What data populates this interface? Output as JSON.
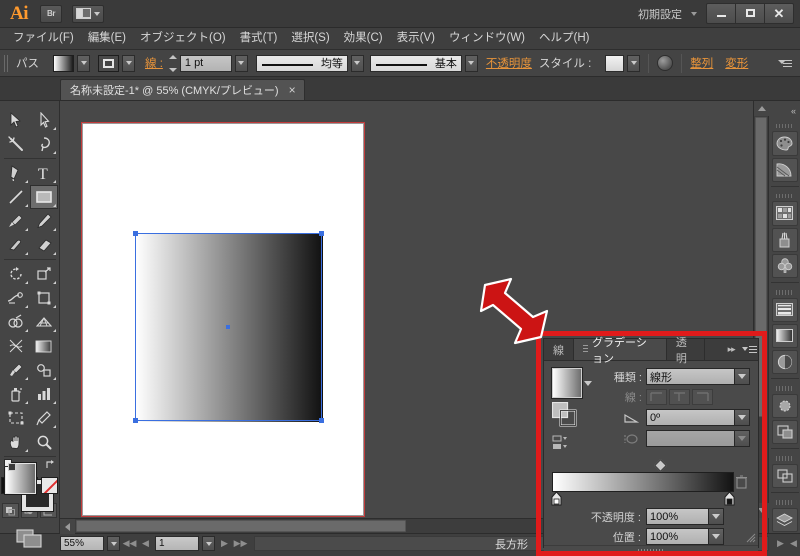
{
  "app": {
    "logo": "Ai",
    "bridge_label": "Br",
    "arrange_label": "arrange-documents",
    "workspace": "初期設定",
    "window_buttons": [
      "minimize",
      "maximize",
      "close"
    ]
  },
  "menubar": {
    "items": [
      {
        "label": "ファイル(F)",
        "name": "menu-file"
      },
      {
        "label": "編集(E)",
        "name": "menu-edit"
      },
      {
        "label": "オブジェクト(O)",
        "name": "menu-object"
      },
      {
        "label": "書式(T)",
        "name": "menu-type"
      },
      {
        "label": "選択(S)",
        "name": "menu-select"
      },
      {
        "label": "効果(C)",
        "name": "menu-effect"
      },
      {
        "label": "表示(V)",
        "name": "menu-view"
      },
      {
        "label": "ウィンドウ(W)",
        "name": "menu-window"
      },
      {
        "label": "ヘルプ(H)",
        "name": "menu-help"
      }
    ]
  },
  "controlbar": {
    "selection_label": "パス",
    "fill_swatch": "gradient-white-to-black",
    "stroke_swatch": "stroke-none",
    "stroke_label": "線 :",
    "stroke_weight": "1 pt",
    "stroke_profile": "均等",
    "brush_definition": "基本",
    "opacity_label": "不透明度",
    "style_label": "スタイル :",
    "style_swatch": "default-style",
    "effects_icon": "fx-circle-icon",
    "align_label": "整列",
    "transform_label": "変形",
    "panel_menu": "panel-menu-icon"
  },
  "tabbar": {
    "document_title": "名称未設定-1* @ 55% (CMYK/プレビュー)",
    "close_glyph": "×"
  },
  "toolbar": {
    "tools": [
      {
        "name": "tool-selection",
        "icon": "arrow-solid-icon"
      },
      {
        "name": "tool-direct-selection",
        "icon": "arrow-hollow-icon"
      },
      {
        "name": "tool-magic-wand",
        "icon": "magic-wand-icon"
      },
      {
        "name": "tool-lasso",
        "icon": "lasso-icon"
      },
      {
        "name": "tool-pen",
        "icon": "pen-icon"
      },
      {
        "name": "tool-type",
        "icon": "type-t-icon"
      },
      {
        "name": "tool-line-segment",
        "icon": "line-icon"
      },
      {
        "name": "tool-rectangle",
        "icon": "rectangle-icon",
        "selected": true
      },
      {
        "name": "tool-paintbrush",
        "icon": "paintbrush-icon"
      },
      {
        "name": "tool-pencil",
        "icon": "pencil-icon"
      },
      {
        "name": "tool-blob-brush",
        "icon": "blob-brush-icon"
      },
      {
        "name": "tool-eraser",
        "icon": "eraser-icon"
      },
      {
        "name": "tool-rotate",
        "icon": "rotate-icon"
      },
      {
        "name": "tool-scale",
        "icon": "scale-icon"
      },
      {
        "name": "tool-width",
        "icon": "width-icon"
      },
      {
        "name": "tool-free-transform",
        "icon": "free-transform-icon"
      },
      {
        "name": "tool-shape-builder",
        "icon": "shape-builder-icon"
      },
      {
        "name": "tool-perspective-grid",
        "icon": "perspective-grid-icon"
      },
      {
        "name": "tool-mesh",
        "icon": "mesh-icon"
      },
      {
        "name": "tool-gradient",
        "icon": "gradient-icon"
      },
      {
        "name": "tool-eyedropper",
        "icon": "eyedropper-icon"
      },
      {
        "name": "tool-blend",
        "icon": "blend-icon"
      },
      {
        "name": "tool-symbol-sprayer",
        "icon": "symbol-sprayer-icon"
      },
      {
        "name": "tool-column-graph",
        "icon": "column-graph-icon"
      },
      {
        "name": "tool-artboard",
        "icon": "artboard-icon"
      },
      {
        "name": "tool-slice",
        "icon": "slice-icon"
      },
      {
        "name": "tool-hand",
        "icon": "hand-icon"
      },
      {
        "name": "tool-zoom",
        "icon": "magnifier-icon"
      }
    ],
    "fill_color": "gradient-white-to-gray",
    "stroke_color": "#2a2a2a",
    "swap_icon": "swap-fill-stroke-icon",
    "default_icon": "default-fill-stroke-icon",
    "color_modes": [
      {
        "name": "color-mode-color",
        "icon": "solid-color-icon"
      },
      {
        "name": "color-mode-gradient",
        "icon": "gradient-swatch-icon"
      },
      {
        "name": "color-mode-none",
        "icon": "none-slash-icon"
      }
    ],
    "draw_modes": [
      {
        "name": "draw-normal",
        "icon": "draw-normal-icon"
      },
      {
        "name": "draw-behind",
        "icon": "draw-behind-icon"
      },
      {
        "name": "draw-inside",
        "icon": "draw-inside-icon"
      }
    ],
    "screen_mode": "change-screen-mode-icon"
  },
  "canvas": {
    "artboard_fill": "#ffffff",
    "object": {
      "name": "gradient-rectangle",
      "fill_from": "#ffffff",
      "fill_to": "#101010",
      "fill_type": "linear"
    },
    "selection_color": "#3a6fe0"
  },
  "gradient_panel": {
    "tabs": [
      {
        "label": "線",
        "name": "tab-stroke",
        "active": false
      },
      {
        "label": "グラデーション",
        "name": "tab-gradient",
        "active": true
      },
      {
        "label": "透明",
        "name": "tab-transparency",
        "active": false
      }
    ],
    "collapse_glyph": "▸▸",
    "menu_icon": "panel-menu-icon",
    "preview_swatch": "gradient-preview-white-to-gray",
    "type_label": "種類 :",
    "type_value": "線形",
    "stroke_label": "線 :",
    "stroke_options": [
      "gradient-within-stroke",
      "gradient-along-stroke",
      "gradient-across-stroke"
    ],
    "angle_label": "angle-icon",
    "angle_value": "0º",
    "aspect_label": "aspect-ratio-icon",
    "aspect_value": "",
    "reverse_icon": "reverse-gradient-icon",
    "ramp": {
      "from": "#ffffff",
      "to": "#131313",
      "midpoint_percent": 57
    },
    "delete_stop_icon": "trash-icon",
    "opacity_label": "不透明度 :",
    "opacity_value": "100%",
    "location_label": "位置 :",
    "location_value": "100%"
  },
  "right_dock": {
    "groups": [
      [
        {
          "name": "dock-color",
          "icon": "color-palette-icon"
        },
        {
          "name": "dock-color-guide",
          "icon": "color-guide-icon"
        }
      ],
      [
        {
          "name": "dock-swatches",
          "icon": "swatches-grid-icon"
        },
        {
          "name": "dock-brushes",
          "icon": "brushes-icon"
        },
        {
          "name": "dock-symbols",
          "icon": "symbols-clover-icon"
        }
      ],
      [
        {
          "name": "dock-stroke",
          "icon": "stroke-lines-icon"
        },
        {
          "name": "dock-gradient",
          "icon": "gradient-panel-icon"
        },
        {
          "name": "dock-transparency",
          "icon": "transparency-icon"
        }
      ],
      [
        {
          "name": "dock-appearance",
          "icon": "appearance-circle-icon"
        },
        {
          "name": "dock-graphic-styles",
          "icon": "graphic-styles-icon"
        }
      ],
      [
        {
          "name": "dock-pathfinder",
          "icon": "pathfinder-icon"
        }
      ],
      [
        {
          "name": "dock-layers",
          "icon": "layers-icon"
        }
      ]
    ]
  },
  "statusbar": {
    "zoom": "55%",
    "page": "1",
    "status_text": "長方形",
    "first_glyph": "◀◀",
    "prev_glyph": "◀",
    "next_glyph": "▶",
    "last_glyph": "▶▶"
  },
  "annotations": {
    "arrow": {
      "name": "red-arrow-annotation",
      "color": "#cc1414"
    },
    "highlight_box": {
      "name": "red-highlight-box",
      "color": "#e01b1b"
    }
  }
}
